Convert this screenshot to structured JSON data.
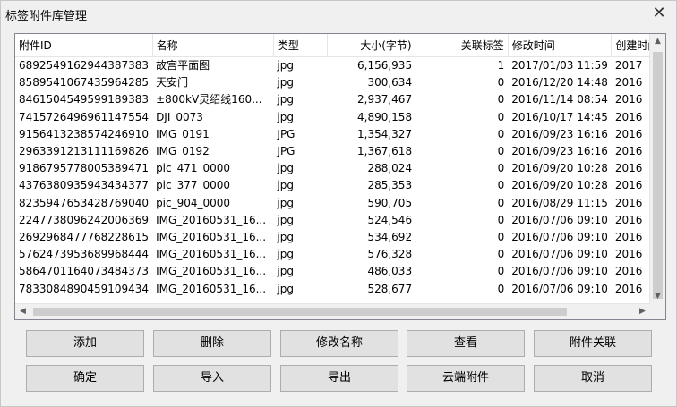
{
  "window": {
    "title": "标签附件库管理",
    "close": "✕"
  },
  "table": {
    "columns": [
      "附件ID",
      "名称",
      "类型",
      "大小(字节)",
      "关联标签",
      "修改时间",
      "创建时间"
    ],
    "rows": [
      [
        "6892549162944387383",
        "故宫平面图",
        "jpg",
        "6,156,935",
        "1",
        "2017/01/03 11:59",
        "2017"
      ],
      [
        "8589541067435964285",
        "天安门",
        "jpg",
        "300,634",
        "0",
        "2016/12/20 14:48",
        "2016"
      ],
      [
        "8461504549599189383",
        "±800kV灵绍线160...",
        "jpg",
        "2,937,467",
        "0",
        "2016/11/14 08:54",
        "2016"
      ],
      [
        "7415726496961147554",
        "DJI_0073",
        "jpg",
        "4,890,158",
        "0",
        "2016/10/17 14:45",
        "2016"
      ],
      [
        "9156413238574246910",
        "IMG_0191",
        "JPG",
        "1,354,327",
        "0",
        "2016/09/23 16:16",
        "2016"
      ],
      [
        "2963391213111169826",
        "IMG_0192",
        "JPG",
        "1,367,618",
        "0",
        "2016/09/23 16:16",
        "2016"
      ],
      [
        "9186795778005389471",
        "pic_471_0000",
        "jpg",
        "288,024",
        "0",
        "2016/09/20 10:28",
        "2016"
      ],
      [
        "4376380935943434377",
        "pic_377_0000",
        "jpg",
        "285,353",
        "0",
        "2016/09/20 10:28",
        "2016"
      ],
      [
        "8235947653428769040",
        "pic_904_0000",
        "jpg",
        "590,705",
        "0",
        "2016/08/29 11:15",
        "2016"
      ],
      [
        "2247738096242006369",
        "IMG_20160531_16...",
        "jpg",
        "524,546",
        "0",
        "2016/07/06 09:10",
        "2016"
      ],
      [
        "2692968477768228615",
        "IMG_20160531_16...",
        "jpg",
        "534,692",
        "0",
        "2016/07/06 09:10",
        "2016"
      ],
      [
        "5762473953689968444",
        "IMG_20160531_16...",
        "jpg",
        "576,328",
        "0",
        "2016/07/06 09:10",
        "2016"
      ],
      [
        "5864701164073484373",
        "IMG_20160531_16...",
        "jpg",
        "486,033",
        "0",
        "2016/07/06 09:10",
        "2016"
      ],
      [
        "7833084890459109434",
        "IMG_20160531_16...",
        "jpg",
        "528,677",
        "0",
        "2016/07/06 09:10",
        "2016"
      ]
    ]
  },
  "scroll": {
    "up": "▲",
    "down": "▼",
    "left": "◀",
    "right": "▶"
  },
  "buttons": {
    "add": "添加",
    "delete": "删除",
    "rename": "修改名称",
    "view": "查看",
    "link": "附件关联",
    "ok": "确定",
    "import": "导入",
    "export": "导出",
    "cloud": "云端附件",
    "cancel": "取消"
  }
}
